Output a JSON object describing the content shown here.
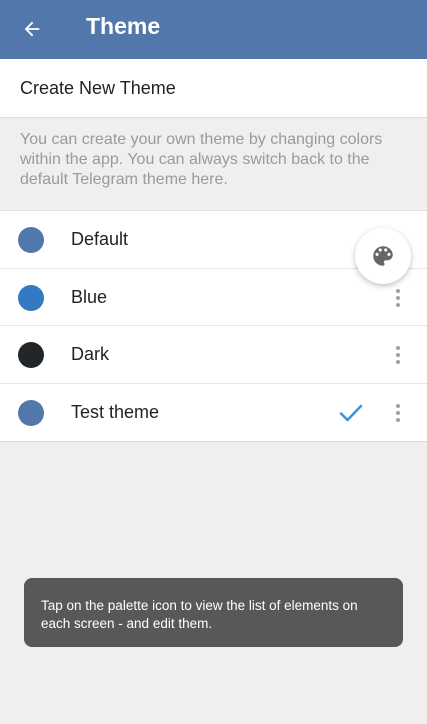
{
  "toolbar": {
    "title": "Theme",
    "back_icon": "arrow-left-icon",
    "background": "#5278ab"
  },
  "create_row": {
    "label": "Create New Theme"
  },
  "info": {
    "text": "You can create your own theme by changing colors within the app. You can always switch back to the default Telegram theme here."
  },
  "themes": [
    {
      "name": "Default",
      "color": "#5278ab",
      "selected": false
    },
    {
      "name": "Blue",
      "color": "#3479c4",
      "selected": false
    },
    {
      "name": "Dark",
      "color": "#232629",
      "selected": false
    },
    {
      "name": "Test theme",
      "color": "#5278ab",
      "selected": true
    }
  ],
  "fab": {
    "icon": "palette-icon"
  },
  "toast": {
    "text": "Tap on the palette icon to view the list of elements on each screen - and edit them."
  },
  "colors": {
    "check": "#3c95e0",
    "more_dots": "#9aa3ab",
    "palette": "#666666"
  }
}
